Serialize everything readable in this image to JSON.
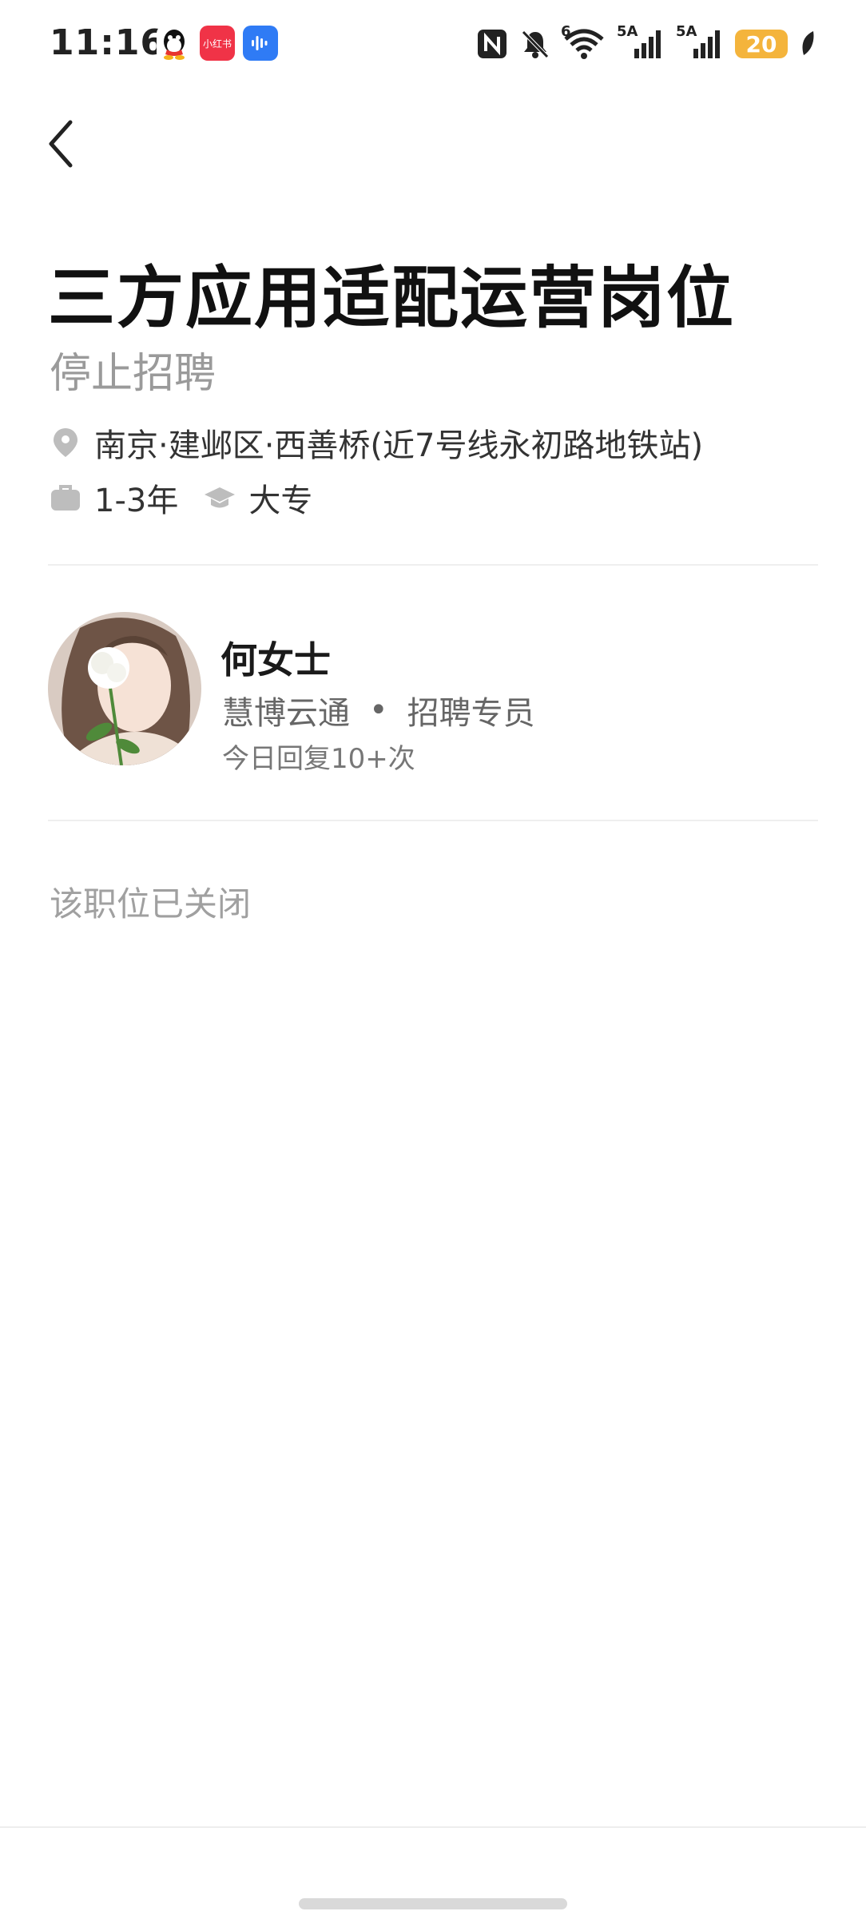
{
  "status_bar": {
    "time": "11:16",
    "app_icons": [
      "qq-icon",
      "xiaohongshu-icon",
      "voice-assistant-icon"
    ],
    "xiaohongshu_label": "小红书",
    "wifi_label": "6",
    "signal1_label": "5A",
    "signal2_label": "5A",
    "battery": "20",
    "colors": {
      "battery": "#f4b43c",
      "xhs": "#f03347",
      "voice": "#2f7bf5"
    }
  },
  "job": {
    "title": "三方应用适配运营岗位",
    "status": "停止招聘",
    "location": "南京·建邺区·西善桥(近7号线永初路地铁站)",
    "experience": "1-3年",
    "education": "大专"
  },
  "recruiter": {
    "name": "何女士",
    "company": "慧博云通",
    "separator": "•",
    "role": "招聘专员",
    "reply_rate": "今日回复10+次"
  },
  "notice": {
    "closed": "该职位已关闭"
  }
}
